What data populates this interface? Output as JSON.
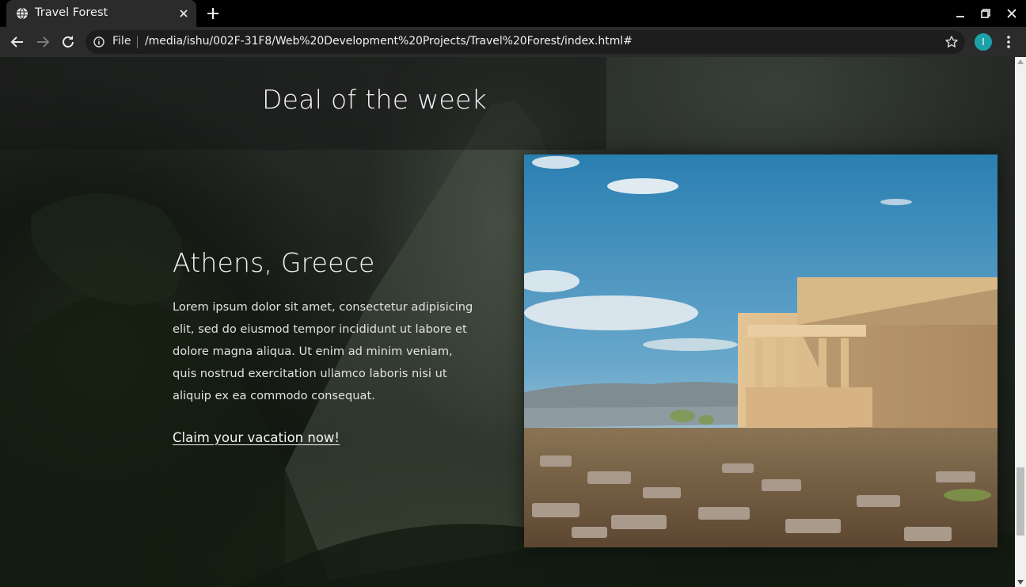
{
  "browser": {
    "tab_title": "Travel Forest",
    "scheme_label": "File",
    "url": "/media/ishu/002F-31F8/Web%20Development%20Projects/Travel%20Forest/index.html#",
    "profile_initial": "I",
    "profile_color": "#1ea0a8"
  },
  "page": {
    "section_title": "Deal of the week",
    "destination": "Athens, Greece",
    "description": "Lorem ipsum dolor sit amet, consectetur adipisicing elit, sed do eiusmod tempor incididunt ut labore et dolore magna aliqua. Ut enim ad minim veniam, quis nostrud exercitation ullamco laboris nisi ut aliquip ex ea commodo consequat.",
    "cta_label": "Claim your vacation now!",
    "photo_subject": "Erechtheion temple ruins on the Acropolis under a blue sky"
  },
  "icons": {
    "tab_favicon": "globe-icon",
    "tab_close": "close-icon",
    "new_tab": "plus-icon",
    "back": "arrow-left-icon",
    "forward": "arrow-right-icon",
    "reload": "reload-icon",
    "site_info": "info-icon",
    "bookmark": "star-icon",
    "menu": "kebab-menu-icon"
  },
  "scroll": {
    "position_fraction": 0.86
  }
}
